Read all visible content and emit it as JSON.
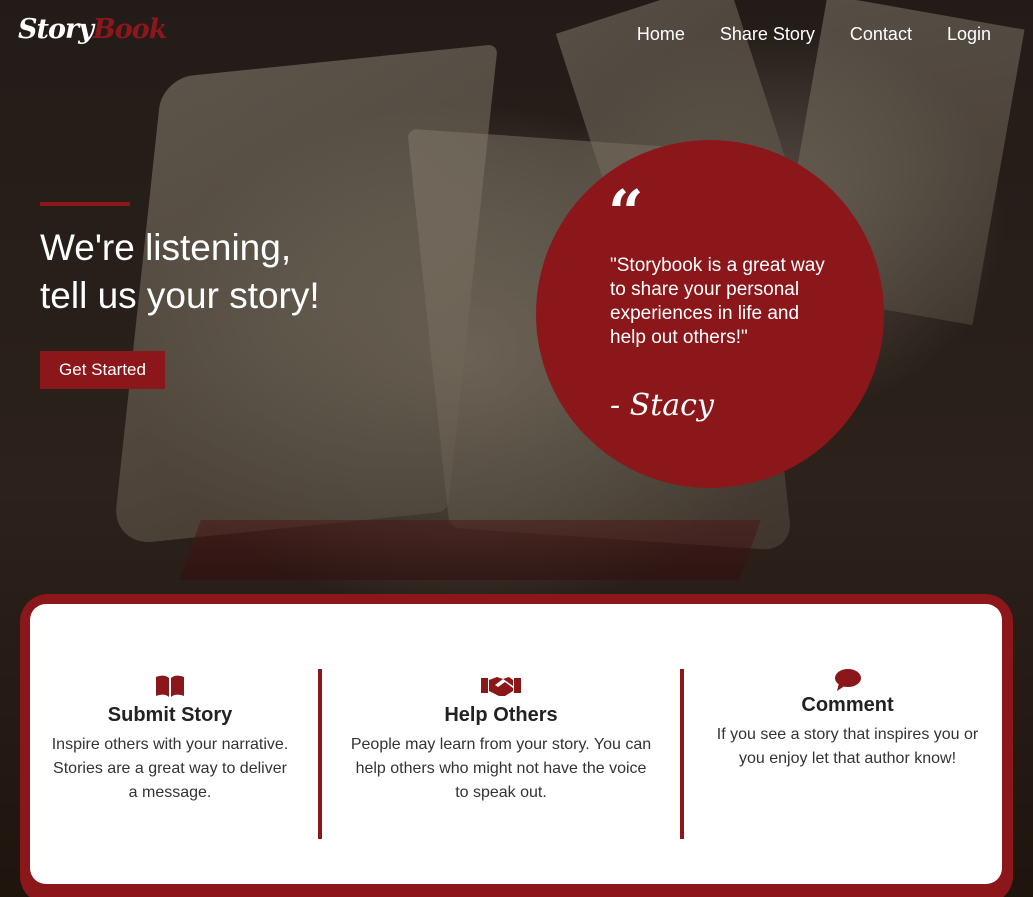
{
  "brand": {
    "logo_part1": "Story",
    "logo_part2": "Book",
    "accent_color": "#8c171b"
  },
  "nav": {
    "items": [
      {
        "label": "Home"
      },
      {
        "label": "Share Story"
      },
      {
        "label": "Contact"
      },
      {
        "label": "Login"
      }
    ]
  },
  "hero": {
    "title_line1": "We're listening,",
    "title_line2": "tell us your story!",
    "cta_label": "Get Started"
  },
  "quote": {
    "mark": "“",
    "text": "\"Storybook is a great way to share your personal experiences in life and help out others!\"",
    "author": "- Stacy",
    "circle_color": "#8c171b"
  },
  "features": [
    {
      "icon": "book-open-icon",
      "title": "Submit Story",
      "description": "Inspire others with your narrative. Stories are a great way to deliver a message."
    },
    {
      "icon": "handshake-icon",
      "title": "Help Others",
      "description": "People may learn from your story. You can help others who might not have the voice to speak out."
    },
    {
      "icon": "comment-icon",
      "title": "Comment",
      "description": "If you see a story that inspires you or you enjoy let that author know!"
    }
  ]
}
